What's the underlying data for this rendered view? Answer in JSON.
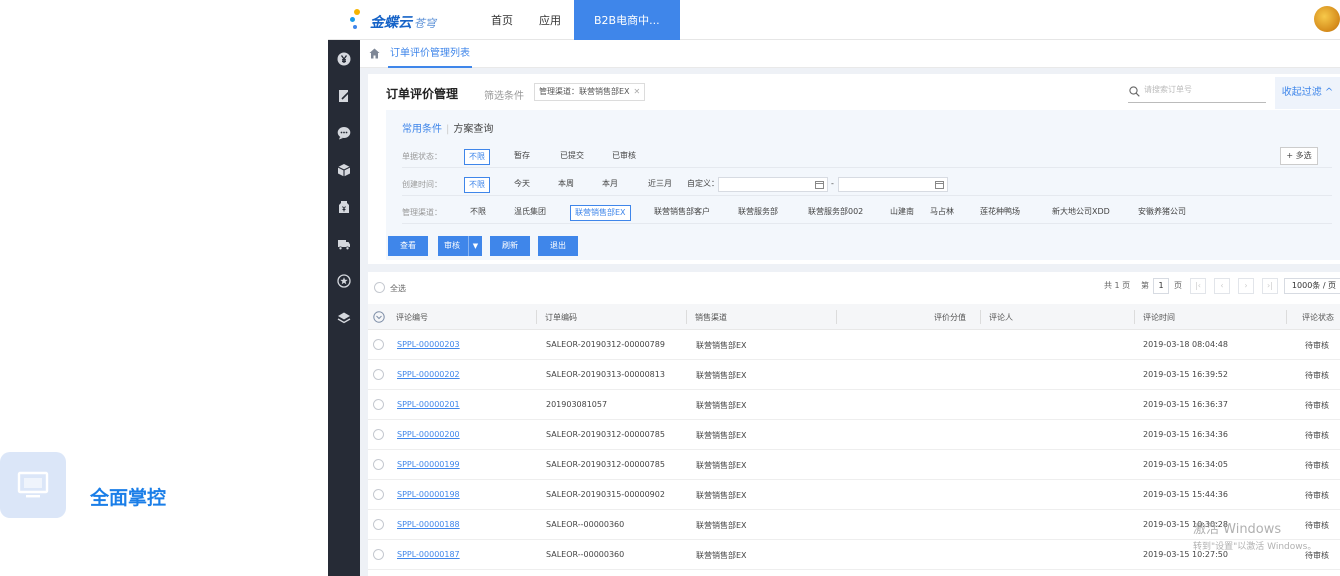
{
  "feature": {
    "label": "全面掌控",
    "icon": "monitor-icon"
  },
  "topbar": {
    "logo_text": "金蝶云",
    "logo_sub": "苍穹",
    "nav": [
      {
        "label": "首页"
      },
      {
        "label": "应用"
      },
      {
        "label": "B2B电商中..."
      }
    ]
  },
  "sidebar_icons": [
    "currency-icon",
    "document-edit-icon",
    "chat-icon",
    "box-icon",
    "price-tag-icon",
    "truck-icon",
    "star-icon",
    "layers-icon"
  ],
  "tabbar": {
    "tab_label": "订单评价管理列表"
  },
  "panel": {
    "title": "订单评价管理",
    "filter_label": "筛选条件",
    "filter_tag": "管理渠道：联营销售部EX",
    "search_placeholder": "请搜索订单号",
    "collapse_label": "收起过滤 ^"
  },
  "conditions": {
    "tab_common": "常用条件",
    "tab_scheme": "方案查询",
    "status": {
      "label": "单据状态：",
      "options": [
        "不限",
        "暂存",
        "已提交",
        "已审核"
      ]
    },
    "created": {
      "label": "创建时间：",
      "options": [
        "不限",
        "今天",
        "本周",
        "本月",
        "近三月",
        "自定义："
      ],
      "date_sep": "-"
    },
    "channel": {
      "label": "管理渠道：",
      "options": [
        "不限",
        "温氏集团",
        "联营销售部EX",
        "联营销售部客户",
        "联营服务部",
        "联营服务部002",
        "山建南",
        "马占林",
        "莲花种鸭场",
        "新大地公司XDD",
        "安徽养猪公司"
      ]
    },
    "multi_select": "+ 多选"
  },
  "toolbar": {
    "view": "查看",
    "audit": "审核",
    "refresh": "刷新",
    "exit": "退出"
  },
  "grid": {
    "select_all": "全选",
    "pager": {
      "total": "共 1 页",
      "page_prefix": "第",
      "page": "1",
      "page_suffix": "页",
      "page_size": "1000条 / 页"
    },
    "columns": [
      "评论编号",
      "订单编码",
      "销售渠道",
      "评价分值",
      "评论人",
      "评论时间",
      "评论状态"
    ],
    "rows": [
      {
        "code": "SPPL-00000203",
        "order": "SALEOR-20190312-00000789",
        "channel": "联营销售部EX",
        "time": "2019-03-18 08:04:48",
        "status": "待审核"
      },
      {
        "code": "SPPL-00000202",
        "order": "SALEOR-20190313-00000813",
        "channel": "联营销售部EX",
        "time": "2019-03-15 16:39:52",
        "status": "待审核"
      },
      {
        "code": "SPPL-00000201",
        "order": "201903081057",
        "channel": "联营销售部EX",
        "time": "2019-03-15 16:36:37",
        "status": "待审核"
      },
      {
        "code": "SPPL-00000200",
        "order": "SALEOR-20190312-00000785",
        "channel": "联营销售部EX",
        "time": "2019-03-15 16:34:36",
        "status": "待审核"
      },
      {
        "code": "SPPL-00000199",
        "order": "SALEOR-20190312-00000785",
        "channel": "联营销售部EX",
        "time": "2019-03-15 16:34:05",
        "status": "待审核"
      },
      {
        "code": "SPPL-00000198",
        "order": "SALEOR-20190315-00000902",
        "channel": "联营销售部EX",
        "time": "2019-03-15 15:44:36",
        "status": "待审核"
      },
      {
        "code": "SPPL-00000188",
        "order": "SALEOR--00000360",
        "channel": "联营销售部EX",
        "time": "2019-03-15 10:30:28",
        "status": "待审核"
      },
      {
        "code": "SPPL-00000187",
        "order": "SALEOR--00000360",
        "channel": "联营销售部EX",
        "time": "2019-03-15 10:27:50",
        "status": "待审核"
      }
    ]
  },
  "watermark": {
    "line1": "激活 Windows",
    "line2": "转到\"设置\"以激活 Windows。"
  },
  "colors": {
    "accent": "#3f86ea",
    "sidebar": "#262b36",
    "feature_text": "#1a7ee8"
  }
}
